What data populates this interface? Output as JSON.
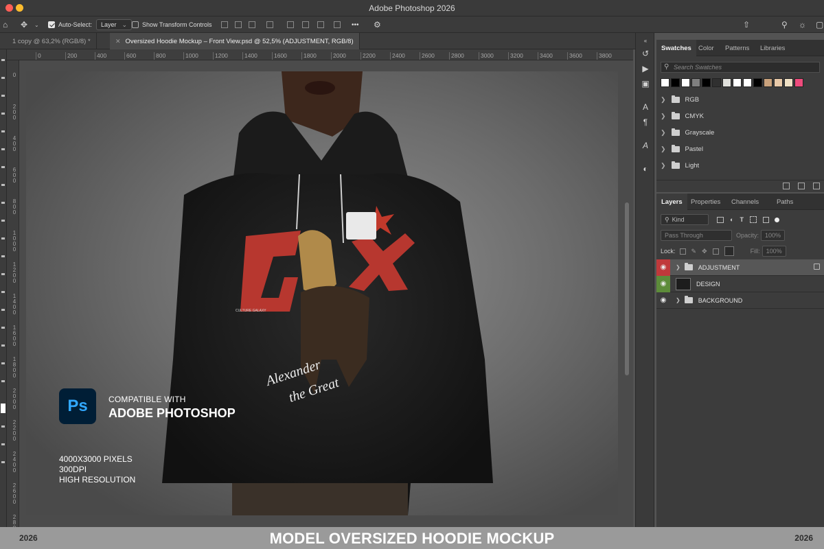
{
  "window": {
    "title": "Adobe Photoshop 2026"
  },
  "options_bar": {
    "auto_select_label": "Auto-Select:",
    "auto_select_value": "Layer",
    "transform_label": "Show Transform Controls",
    "more_label": "•••"
  },
  "tabs": [
    {
      "label": "1 copy @ 63,2% (RGB/8) *"
    },
    {
      "label": "Oversized Hoodie Mockup – Front View.psd @ 52,5% (ADJUSTMENT, RGB/8)"
    }
  ],
  "ruler": {
    "h_ticks": [
      "0",
      "200",
      "400",
      "600",
      "800",
      "1000",
      "1200",
      "1400",
      "1600",
      "1800",
      "2000",
      "2200",
      "2400",
      "2600",
      "2800",
      "3000",
      "3200",
      "3400",
      "3600",
      "3800"
    ],
    "v_ticks": [
      "0",
      "200",
      "400",
      "600",
      "800",
      "1000",
      "1200",
      "1400",
      "1600",
      "1800",
      "2000",
      "2200",
      "2400",
      "2600",
      "2800"
    ]
  },
  "canvas": {
    "compat_line1": "COMPATIBLE WITH",
    "compat_line2": "ADOBE PHOTOSHOP",
    "ps_logo": "Ps",
    "spec_lines": [
      "4000X3000 PIXELS",
      "300DPI",
      "HIGH RESOLUTION"
    ],
    "shirt_brand": "CULTURE GALAXY",
    "script_line1": "Alexander",
    "script_line2": "the Great"
  },
  "swatches_panel": {
    "tabs": [
      "Swatches",
      "Color",
      "Patterns",
      "Libraries"
    ],
    "search_placeholder": "Search Swatches",
    "colors": [
      "#ffffff",
      "#000000",
      "#ffffff",
      "#808080",
      "#000000",
      "#303030",
      "#e0e0dc",
      "#ffffff",
      "#ffffff",
      "#000000",
      "#c9a27c",
      "#e8c9a8",
      "#efe0c4",
      "#ee4b7c"
    ],
    "groups": [
      "RGB",
      "CMYK",
      "Grayscale",
      "Pastel",
      "Light"
    ]
  },
  "layers_panel": {
    "tabs": [
      "Layers",
      "Properties",
      "Channels",
      "Paths"
    ],
    "kind_label": "Kind",
    "blend_mode": "Pass Through",
    "opacity_label": "Opacity:",
    "opacity_value": "100%",
    "lock_label": "Lock:",
    "fill_label": "Fill:",
    "fill_value": "100%",
    "layers": [
      {
        "name": "ADJUSTMENT",
        "type": "group"
      },
      {
        "name": "DESIGN",
        "type": "smart"
      },
      {
        "name": "BACKGROUND",
        "type": "group"
      }
    ]
  },
  "banner": {
    "year_left": "2026",
    "title": "MODEL OVERSIZED HOODIE MOCKUP",
    "year_right": "2026"
  }
}
